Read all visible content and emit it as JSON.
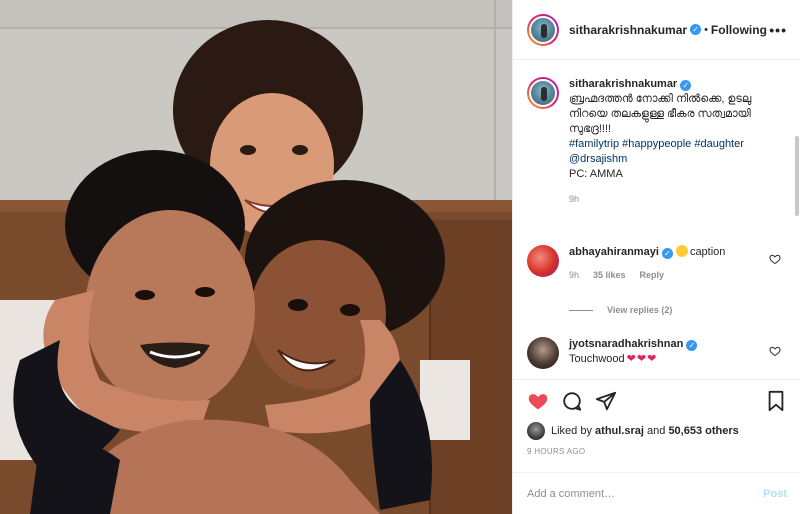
{
  "post": {
    "author": "sitharakrishnakumar",
    "follow_sep": "•",
    "follow_label": "Following",
    "more_label": "•••"
  },
  "caption": {
    "author": "sitharakrishnakumar",
    "text": "ബ്രഹ്മദത്തൻ നോക്കി നിൽക്കെ, ഉടലു നിറയെ തലകളുള്ള ഭീകര സത്വമായി സുഭദ്ര!!!!",
    "hashtags": "#familytrip #happypeople #daughter",
    "mention": "@drsajishm",
    "credit": "PC: AMMA",
    "time": "9h"
  },
  "comments": [
    {
      "author": "abhayahiranmayi",
      "text": "caption",
      "time": "9h",
      "likes": "35 likes",
      "reply": "Reply"
    },
    {
      "author": "jyotsnaradhakrishnan",
      "text": "Touchwood",
      "hearts": "❤❤❤"
    }
  ],
  "view_replies": "View replies (2)",
  "likes": {
    "prefix": "Liked by",
    "user": "athul.sraj",
    "middle": "and",
    "count": "50,653 others"
  },
  "posted_time": "9 HOURS AGO",
  "add_comment": {
    "placeholder": "Add a comment…",
    "post_label": "Post"
  },
  "icons": {
    "like": "heart-filled-icon",
    "comment": "comment-icon",
    "share": "share-icon",
    "save": "bookmark-icon"
  },
  "colors": {
    "like": "#ed4956",
    "verified": "#3897f0",
    "link": "#003569",
    "muted": "#8e8e8e"
  }
}
